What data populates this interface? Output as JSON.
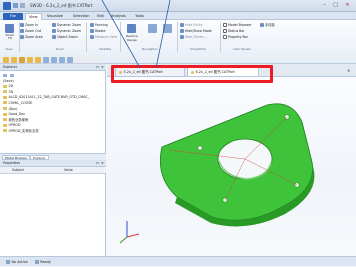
{
  "window": {
    "title": "SW3D - 6.2x_2_ed 图书.CATPart",
    "min": "–",
    "max": "□",
    "close": "✕"
  },
  "menu": {
    "file": "File",
    "tabs": [
      "View",
      "Visualize",
      "Selection",
      "Edit",
      "Analysis",
      "Tools"
    ]
  },
  "ribbon": {
    "zoom": [
      "Zoom In",
      "Zoom Out",
      "Zoom Area"
    ],
    "zoom_big": "Zoom\nFit",
    "dynamic": [
      "Dynamic Zoom",
      "Dynamic Zoom",
      "Object Zoom"
    ],
    "nav": [
      "Panning",
      "Rotate",
      "Measure View"
    ],
    "restore": "Restore Range",
    "show": [
      "Hide Entity",
      "Hide/Show Mode",
      "Hide Dimen..."
    ],
    "panels": [
      "Model Browser",
      "Status Bar",
      "Property Bar"
    ],
    "single": "手动选",
    "group_labels": [
      "View",
      "Zoom",
      "Visibility",
      "Navigation",
      "Show/Hide",
      "User Panels"
    ]
  },
  "explorer": {
    "title": "Explorer",
    "items": [
      "(Save)",
      "2D",
      "3D",
      "ALCD_02013411_22_TAB_GATE-BVR_OTD_CMAC_",
      "COMIL_COOSE",
      "(Doc)",
      "Good_Doc",
      "我的业务案例",
      "OPROD",
      "OPROD_实例化业务"
    ]
  },
  "panel_tabs": [
    "Model Browser",
    "Explorer"
  ],
  "properties": {
    "title": "Properties",
    "col_subject": "Subject",
    "col_value": "Value"
  },
  "doc_tabs": [
    "5.2x_2_ed 图书.CATPart",
    "6.2x_2_ed 图书.CATPart"
  ],
  "status": {
    "left": "No Active",
    "right": "Ready"
  },
  "colors": {
    "accent": "#2d63b8",
    "part": "#3fc33a",
    "highlight": "#ec1b24"
  }
}
